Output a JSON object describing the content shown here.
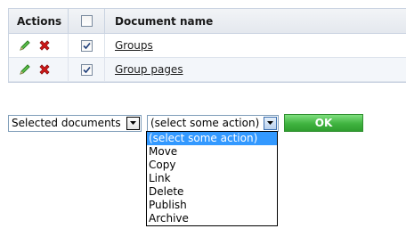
{
  "grid": {
    "headers": {
      "actions": "Actions",
      "document_name": "Document name"
    },
    "header_checkbox_checked": false,
    "rows": [
      {
        "name": "Groups",
        "checked": true
      },
      {
        "name": "Group pages",
        "checked": true
      }
    ]
  },
  "bulk_actions": {
    "scope_select": {
      "value": "Selected documents"
    },
    "action_select": {
      "value": "(select some action)"
    },
    "ok_label": "OK",
    "options": [
      "(select some action)",
      "Move",
      "Copy",
      "Link",
      "Delete",
      "Publish",
      "Archive"
    ],
    "selected_option_index": 0
  },
  "colors": {
    "ok_button": "#3fb33f",
    "selected_option": "#3399ff",
    "delete_icon": "#d01818",
    "edit_icon": "#3aa233"
  },
  "icons": {
    "edit": "pencil-icon",
    "delete": "delete-x-icon",
    "dropdown": "chevron-down-icon"
  }
}
